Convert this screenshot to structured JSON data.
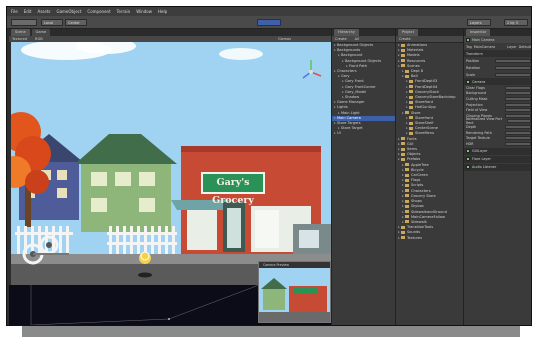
{
  "menu": [
    "File",
    "Edit",
    "Assets",
    "GameObject",
    "Component",
    "Terrain",
    "Window",
    "Help"
  ],
  "toolbar": {
    "local_label": "Local",
    "center_label": "Center",
    "layers_label": "Layers",
    "layout_label": "2 by 3"
  },
  "scene_panel": {
    "tabs": [
      "Scene",
      "Game"
    ],
    "shading": "Textured",
    "mode": "RGB",
    "gizmos": "Gizmos"
  },
  "store_sign": "Gary's Grocery",
  "camera_preview": {
    "title": "Camera Preview"
  },
  "hierarchy": {
    "tab": "Hierarchy",
    "create": "Create",
    "search": "All",
    "items": [
      {
        "label": "Background Objects",
        "indent": 0
      },
      {
        "label": "Backgrounds",
        "indent": 0
      },
      {
        "label": "Background",
        "indent": 1
      },
      {
        "label": "Background Objects",
        "indent": 2
      },
      {
        "label": "Front Path",
        "indent": 3
      },
      {
        "label": "Characters",
        "indent": 0
      },
      {
        "label": "Gary",
        "indent": 1
      },
      {
        "label": "Gary Front",
        "indent": 2
      },
      {
        "label": "Gary FrontCorner",
        "indent": 2
      },
      {
        "label": "Gary_Model",
        "indent": 2
      },
      {
        "label": "Shadow",
        "indent": 2
      },
      {
        "label": "Game Manager",
        "indent": 0
      },
      {
        "label": "Lights",
        "indent": 0
      },
      {
        "label": "Main Light",
        "indent": 1
      },
      {
        "label": "Main Camera",
        "indent": 0,
        "selected": true
      },
      {
        "label": "Store Targets",
        "indent": 0
      },
      {
        "label": "Store Target",
        "indent": 1
      },
      {
        "label": "UI",
        "indent": 0
      }
    ]
  },
  "project": {
    "tab": "Project",
    "create": "Create",
    "items": [
      {
        "label": "Animations",
        "indent": 0
      },
      {
        "label": "Materials",
        "indent": 0
      },
      {
        "label": "Models",
        "indent": 0
      },
      {
        "label": "Resources",
        "indent": 0
      },
      {
        "label": "Scenes",
        "indent": 0
      },
      {
        "label": "Dept 8",
        "indent": 1
      },
      {
        "label": "Ball",
        "indent": 1
      },
      {
        "label": "FrontDept03",
        "indent": 2
      },
      {
        "label": "FrontDept04",
        "indent": 2
      },
      {
        "label": "GroceryStock",
        "indent": 2
      },
      {
        "label": "GroceryStoreBackdrop",
        "indent": 2
      },
      {
        "label": "Storefront",
        "indent": 2
      },
      {
        "label": "HotGunUpp",
        "indent": 2
      },
      {
        "label": "Store",
        "indent": 1
      },
      {
        "label": "Storefront",
        "indent": 2
      },
      {
        "label": "StoreShelf",
        "indent": 2
      },
      {
        "label": "CenterScene",
        "indent": 2
      },
      {
        "label": "StoreMenu",
        "indent": 2
      },
      {
        "label": "Fonts",
        "indent": 0
      },
      {
        "label": "GUI",
        "indent": 0
      },
      {
        "label": "Items",
        "indent": 0
      },
      {
        "label": "Objects",
        "indent": 0
      },
      {
        "label": "Prefabs",
        "indent": 0
      },
      {
        "label": "AppleTree",
        "indent": 1
      },
      {
        "label": "Bicycle",
        "indent": 1
      },
      {
        "label": "CarGreen",
        "indent": 1
      },
      {
        "label": "Flags",
        "indent": 1
      },
      {
        "label": "Scripts",
        "indent": 1
      },
      {
        "label": "Characters",
        "indent": 1
      },
      {
        "label": "Grocery Store",
        "indent": 1
      },
      {
        "label": "Shops",
        "indent": 1
      },
      {
        "label": "Skybox",
        "indent": 1
      },
      {
        "label": "SidewalkandGround",
        "indent": 1
      },
      {
        "label": "MainCameraFollow",
        "indent": 1
      },
      {
        "label": "Sidewalk",
        "indent": 1
      },
      {
        "label": "TransitionTools",
        "indent": 0
      },
      {
        "label": "Sounds",
        "indent": 0
      },
      {
        "label": "Textures",
        "indent": 0
      }
    ]
  },
  "inspector": {
    "tab": "Inspector",
    "object_name": "Main Camera",
    "tag_label": "Tag",
    "tag_value": "MainCamera",
    "layer_label": "Layer",
    "layer_value": "Default",
    "transform": {
      "title": "Transform",
      "position": "Position",
      "rotation": "Rotation",
      "scale": "Scale"
    },
    "camera": {
      "title": "Camera",
      "rows": [
        "Clear Flags",
        "Background",
        "Culling Mask",
        "Projection",
        "Field of View",
        "Clipping Planes",
        "Normalized View Port Rect",
        "Depth",
        "Rendering Path",
        "Target Texture",
        "HDR"
      ]
    },
    "components": [
      "GUILayer",
      "Flare Layer",
      "Audio Listener"
    ]
  },
  "colors": {
    "selection": "#3d61a8",
    "sign_green": "#2a9257",
    "brick": "#c64a34",
    "sky": "#9fd3f1"
  }
}
